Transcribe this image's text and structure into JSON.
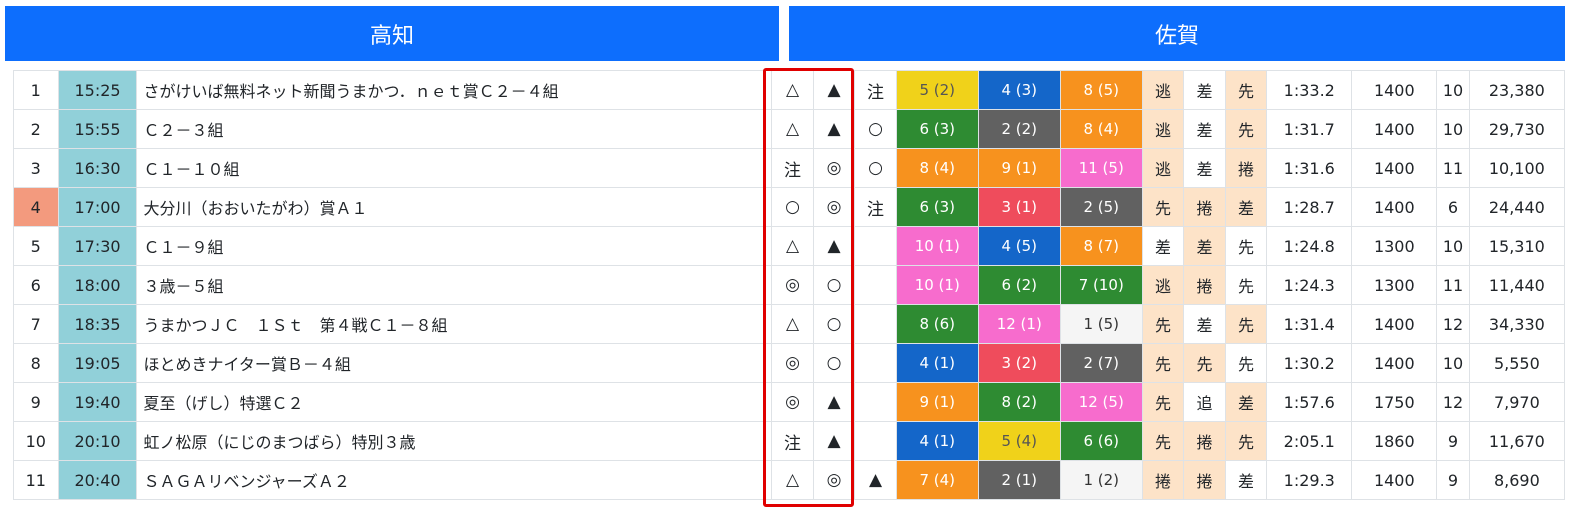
{
  "headers": {
    "left": "高知",
    "right": "佐賀"
  },
  "colors": {
    "header_bg": "#0d6efd",
    "time_bg": "#91d0d9",
    "highlight_num_bg": "#f39a7e",
    "style_bg": "#fde3c8",
    "frame_highlight": "#e00000",
    "gate": {
      "1": {
        "bg": "#f5f5f5",
        "fg": "#333333"
      },
      "2": {
        "bg": "#616161",
        "fg": "#ffffff"
      },
      "3": {
        "bg": "#ef4c5c",
        "fg": "#ffffff"
      },
      "4": {
        "bg": "#1466c9",
        "fg": "#ffffff"
      },
      "5": {
        "bg": "#f0d21a",
        "fg": "#555555"
      },
      "6": {
        "bg": "#2e8b32",
        "fg": "#ffffff"
      },
      "7": {
        "bg": "#f7921e",
        "fg": "#ffffff"
      },
      "8": {
        "bg": "#f76ccd",
        "fg": "#ffffff"
      }
    }
  },
  "rows": [
    {
      "num": "1",
      "time": "15:25",
      "name": "さがけいば無料ネット新聞うまかつ．ｎｅｔ賞Ｃ２－４組",
      "m1": "△",
      "m2": "▲",
      "m3": "注",
      "h1": {
        "text": "5 (2)",
        "gate": "5"
      },
      "h2": {
        "text": "4 (3)",
        "gate": "4"
      },
      "h3": {
        "text": "8 (5)",
        "gate": "7"
      },
      "s1": "逃",
      "s2": "差",
      "s3": "先",
      "s1h": true,
      "s2h": false,
      "s3h": true,
      "t": "1:33.2",
      "d": "1400",
      "n": "10",
      "p": "23,380"
    },
    {
      "num": "2",
      "time": "15:55",
      "name": "Ｃ２－３組",
      "m1": "△",
      "m2": "▲",
      "m3": "○",
      "h1": {
        "text": "6 (3)",
        "gate": "6"
      },
      "h2": {
        "text": "2 (2)",
        "gate": "2"
      },
      "h3": {
        "text": "8 (4)",
        "gate": "7"
      },
      "s1": "逃",
      "s2": "差",
      "s3": "先",
      "s1h": true,
      "s2h": false,
      "s3h": true,
      "t": "1:31.7",
      "d": "1400",
      "n": "10",
      "p": "29,730"
    },
    {
      "num": "3",
      "time": "16:30",
      "name": "Ｃ１－１０組",
      "m1": "注",
      "m2": "◎",
      "m3": "○",
      "h1": {
        "text": "8 (4)",
        "gate": "7"
      },
      "h2": {
        "text": "9 (1)",
        "gate": "7"
      },
      "h3": {
        "text": "11 (5)",
        "gate": "8"
      },
      "s1": "逃",
      "s2": "差",
      "s3": "捲",
      "s1h": true,
      "s2h": false,
      "s3h": true,
      "t": "1:31.6",
      "d": "1400",
      "n": "11",
      "p": "10,100"
    },
    {
      "num": "4",
      "time": "17:00",
      "name": "大分川（おおいたがわ）賞Ａ１",
      "m1": "○",
      "m2": "◎",
      "m3": "注",
      "hl": true,
      "h1": {
        "text": "6 (3)",
        "gate": "6"
      },
      "h2": {
        "text": "3 (1)",
        "gate": "3"
      },
      "h3": {
        "text": "2 (5)",
        "gate": "2"
      },
      "s1": "先",
      "s2": "捲",
      "s3": "差",
      "s1h": true,
      "s2h": true,
      "s3h": true,
      "t": "1:28.7",
      "d": "1400",
      "n": "6",
      "p": "24,440"
    },
    {
      "num": "5",
      "time": "17:30",
      "name": "Ｃ１－９組",
      "m1": "△",
      "m2": "▲",
      "m3": "",
      "h1": {
        "text": "10 (1)",
        "gate": "8"
      },
      "h2": {
        "text": "4 (5)",
        "gate": "4"
      },
      "h3": {
        "text": "8 (7)",
        "gate": "7"
      },
      "s1": "差",
      "s2": "差",
      "s3": "先",
      "s1h": false,
      "s2h": true,
      "s3h": false,
      "t": "1:24.8",
      "d": "1300",
      "n": "10",
      "p": "15,310"
    },
    {
      "num": "6",
      "time": "18:00",
      "name": "３歳－５組",
      "m1": "◎",
      "m2": "○",
      "m3": "",
      "h1": {
        "text": "10 (1)",
        "gate": "8"
      },
      "h2": {
        "text": "6 (2)",
        "gate": "6"
      },
      "h3": {
        "text": "7 (10)",
        "gate": "6"
      },
      "s1": "逃",
      "s2": "捲",
      "s3": "先",
      "s1h": true,
      "s2h": true,
      "s3h": false,
      "t": "1:24.3",
      "d": "1300",
      "n": "11",
      "p": "11,440"
    },
    {
      "num": "7",
      "time": "18:35",
      "name": "うまかつＪＣ　１Ｓｔ　第４戦Ｃ１－８組",
      "m1": "△",
      "m2": "○",
      "m3": "",
      "h1": {
        "text": "8 (6)",
        "gate": "6"
      },
      "h2": {
        "text": "12 (1)",
        "gate": "8"
      },
      "h3": {
        "text": "1 (5)",
        "gate": "1"
      },
      "s1": "先",
      "s2": "差",
      "s3": "先",
      "s1h": true,
      "s2h": false,
      "s3h": true,
      "t": "1:31.4",
      "d": "1400",
      "n": "12",
      "p": "34,330"
    },
    {
      "num": "8",
      "time": "19:05",
      "name": "ほとめきナイター賞Ｂ－４組",
      "m1": "◎",
      "m2": "○",
      "m3": "",
      "h1": {
        "text": "4 (1)",
        "gate": "4"
      },
      "h2": {
        "text": "3 (2)",
        "gate": "3"
      },
      "h3": {
        "text": "2 (7)",
        "gate": "2"
      },
      "s1": "先",
      "s2": "先",
      "s3": "先",
      "s1h": true,
      "s2h": true,
      "s3h": false,
      "t": "1:30.2",
      "d": "1400",
      "n": "10",
      "p": "5,550"
    },
    {
      "num": "9",
      "time": "19:40",
      "name": "夏至（げし）特選Ｃ２",
      "m1": "◎",
      "m2": "▲",
      "m3": "",
      "h1": {
        "text": "9 (1)",
        "gate": "7"
      },
      "h2": {
        "text": "8 (2)",
        "gate": "6"
      },
      "h3": {
        "text": "12 (5)",
        "gate": "8"
      },
      "s1": "先",
      "s2": "追",
      "s3": "差",
      "s1h": true,
      "s2h": false,
      "s3h": true,
      "t": "1:57.6",
      "d": "1750",
      "n": "12",
      "p": "7,970"
    },
    {
      "num": "10",
      "time": "20:10",
      "name": "虹ノ松原（にじのまつばら）特別３歳",
      "m1": "注",
      "m2": "▲",
      "m3": "",
      "h1": {
        "text": "4 (1)",
        "gate": "4"
      },
      "h2": {
        "text": "5 (4)",
        "gate": "5"
      },
      "h3": {
        "text": "6 (6)",
        "gate": "6"
      },
      "s1": "先",
      "s2": "捲",
      "s3": "先",
      "s1h": true,
      "s2h": true,
      "s3h": true,
      "t": "2:05.1",
      "d": "1860",
      "n": "9",
      "p": "11,670"
    },
    {
      "num": "11",
      "time": "20:40",
      "name": "ＳＡＧＡリベンジャーズＡ２",
      "m1": "△",
      "m2": "◎",
      "m3": "▲",
      "h1": {
        "text": "7 (4)",
        "gate": "7"
      },
      "h2": {
        "text": "2 (1)",
        "gate": "2"
      },
      "h3": {
        "text": "1 (2)",
        "gate": "1"
      },
      "s1": "捲",
      "s2": "捲",
      "s3": "差",
      "s1h": true,
      "s2h": true,
      "s3h": false,
      "t": "1:29.3",
      "d": "1400",
      "n": "9",
      "p": "8,690"
    }
  ]
}
